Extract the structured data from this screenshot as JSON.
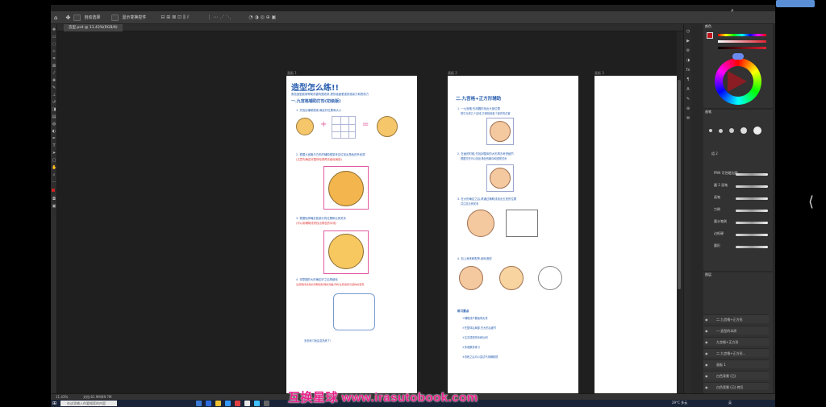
{
  "app": {
    "options_bar": {
      "label_1": "自动选择",
      "label_2": "显示变换控件"
    },
    "doc_tab": "造型.psd @ 11.43%(RGB/8)",
    "artboards": {
      "a1": "画板 1",
      "a2": "画板 2",
      "a3": "画板 3"
    },
    "status": {
      "zoom": "11.43%",
      "doc": "文档:81.9M/89.7M"
    },
    "taskbar": {
      "search_placeholder": "在这里输入你要搜索的内容",
      "weather": "29°C 多云",
      "lang": "英"
    },
    "panels": {
      "color_title": "颜色",
      "brush_title": "画笔",
      "layers_title": "图层",
      "brush_folder": "组 2",
      "brushes": [
        "PRN 可控硬边圆",
        "圆 2 画笔",
        "画笔",
        "力刷",
        "墨水笔刷",
        "边框硬",
        "圆形"
      ],
      "layers": [
        "二.九宫格+正方形",
        "一.造型的本质",
        "九宫格+正方形",
        "二.九宫格+正方形...",
        "画板 1",
        "白色背景 (已)",
        "白色背景 (已) 拷贝"
      ]
    }
  },
  "page1": {
    "title": "造型怎么练!!",
    "intro": "角色造型能够帮助改善构图线条,提供画面更强的感染力和表现力",
    "section": "一.九宫格辅助打形(初级版)",
    "step1": "1. 先找出辅助框架,确定好位置和大小",
    "step2": "2. 根据九宫格与方形的辅助框架来定位找出角色的外轮廓",
    "step2_note": "(注意先确定好整体轮廓再去细化局部)",
    "step3": "3. 根据轮廓确定各部分的位置和比例关系",
    "step3_note": "(可以用辅助线来找出角色的中线)",
    "step4": "4. 将草图的大形确定好之后再细化",
    "step4_note": "注意保持线条的流畅和轮廓的完整,同时注意透视与结构的表现",
    "footer": "多多练习就会变熟练了!"
  },
  "page2": {
    "section": "二.九宫格+正方形辅助",
    "s1": "1. 一九宫格:先用圆形找出头部位置",
    "s1_note": "把它分成几个区域,方便找到各个部件的位置",
    "s2": "2. 在画的时候,先找到整体的大形再去考虑细节",
    "s2_note": "根据方形可以找出角色的朝向和透视关系",
    "s3": "3. 在大形确定之后,再通过辅助线找出五官的位置",
    "s3_note": "并注意比例关系",
    "s4": "4. 加上身体和配饰,细化造型",
    "summary_title": "练习要点",
    "summary": [
      "①辅助线不要画得太重",
      "②先整体后局部,先大形后细节",
      "③注意透视关系和比例",
      "④多观察多练习",
      "⑤熟练之后可以尝试不用辅助框"
    ]
  },
  "watermark": "互换星球 www.irasutobook.com",
  "colors": {
    "page_title": "#2a5fb0",
    "note_red": "#e03a3a",
    "orange": "#f0b050",
    "watermark": "#e8208a"
  }
}
